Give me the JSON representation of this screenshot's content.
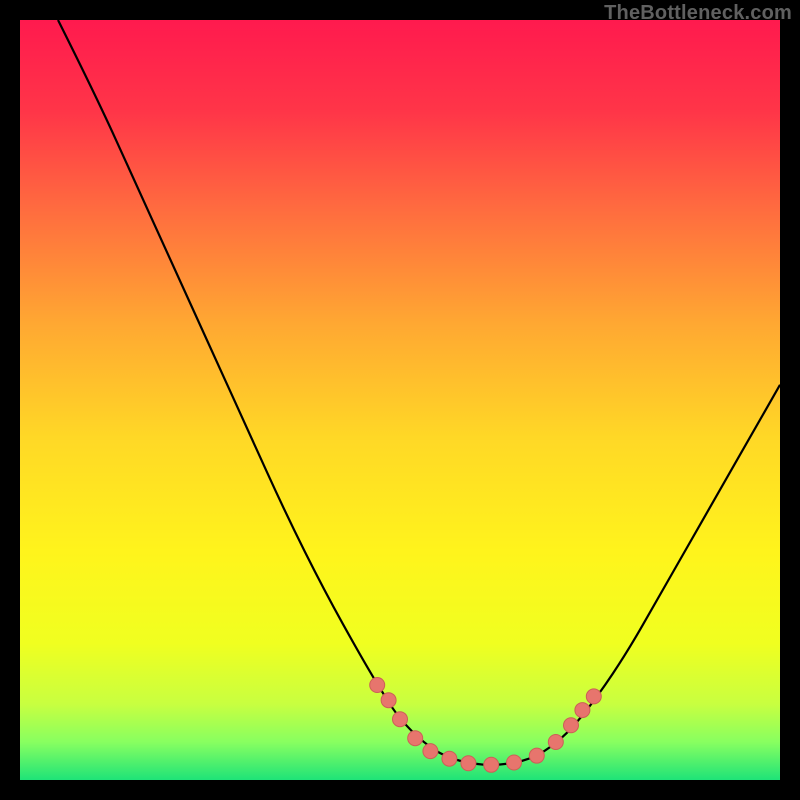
{
  "attribution": "TheBottleneck.com",
  "colors": {
    "frame": "#000000",
    "curve": "#000000",
    "marker_fill": "#E7756D",
    "marker_stroke": "#CC5F57",
    "gradient_stops": [
      {
        "offset": 0.0,
        "color": "#FF1A4E"
      },
      {
        "offset": 0.12,
        "color": "#FF3548"
      },
      {
        "offset": 0.25,
        "color": "#FF6C3F"
      },
      {
        "offset": 0.4,
        "color": "#FFA832"
      },
      {
        "offset": 0.55,
        "color": "#FFD826"
      },
      {
        "offset": 0.7,
        "color": "#FFF41C"
      },
      {
        "offset": 0.82,
        "color": "#F0FF20"
      },
      {
        "offset": 0.9,
        "color": "#C8FF40"
      },
      {
        "offset": 0.95,
        "color": "#88FF60"
      },
      {
        "offset": 1.0,
        "color": "#1EE378"
      }
    ]
  },
  "chart_data": {
    "type": "line",
    "title": "",
    "xlabel": "",
    "ylabel": "",
    "xlim": [
      0,
      100
    ],
    "ylim": [
      0,
      100
    ],
    "grid": false,
    "legend": false,
    "series": [
      {
        "name": "curve",
        "x": [
          5,
          10,
          15,
          20,
          25,
          30,
          35,
          40,
          45,
          48,
          50,
          53,
          56,
          60,
          64,
          68,
          72,
          76,
          80,
          84,
          88,
          92,
          96,
          100
        ],
        "y": [
          100,
          90,
          79,
          68,
          57,
          46,
          35,
          25,
          16,
          11,
          8,
          5,
          3,
          2,
          2,
          3,
          6,
          11,
          17,
          24,
          31,
          38,
          45,
          52
        ]
      }
    ],
    "markers": {
      "name": "scatter-points",
      "x": [
        47,
        48.5,
        50,
        52,
        54,
        56.5,
        59,
        62,
        65,
        68,
        70.5,
        72.5,
        74,
        75.5
      ],
      "y": [
        12.5,
        10.5,
        8,
        5.5,
        3.8,
        2.8,
        2.2,
        2.0,
        2.3,
        3.2,
        5,
        7.2,
        9.2,
        11
      ]
    }
  }
}
